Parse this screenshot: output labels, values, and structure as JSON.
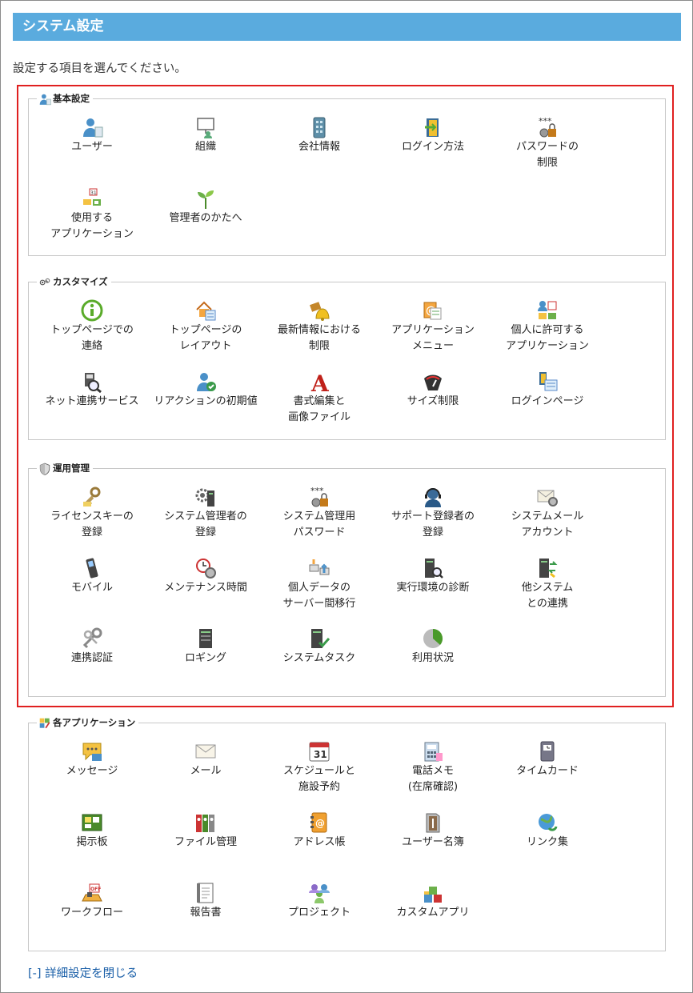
{
  "page": {
    "title": "システム設定",
    "instruction": "設定する項目を選んでください。",
    "footer_link": "[-] 詳細設定を閉じる"
  },
  "colors": {
    "header": "#5aabde",
    "highlight": "#e02020",
    "link": "#1a5fa8"
  },
  "sections": [
    {
      "title": "基本設定",
      "icon": "user-icon",
      "items": [
        {
          "label": "ユーザー",
          "icon": "user-icon"
        },
        {
          "label": "組織",
          "icon": "organization-icon"
        },
        {
          "label": "会社情報",
          "icon": "building-icon"
        },
        {
          "label": "ログイン方法",
          "icon": "door-icon"
        },
        {
          "label": "パスワードの\n制限",
          "icon": "password-lock-icon"
        },
        {
          "label": "使用する\nアプリケーション",
          "icon": "apps-icon"
        },
        {
          "label": "管理者のかたへ",
          "icon": "sprout-icon"
        }
      ]
    },
    {
      "title": "カスタマイズ",
      "icon": "gear-wrench-icon",
      "items": [
        {
          "label": "トップページでの\n連絡",
          "icon": "info-icon"
        },
        {
          "label": "トップページの\nレイアウト",
          "icon": "home-layout-icon"
        },
        {
          "label": "最新情報における\n制限",
          "icon": "bell-icon"
        },
        {
          "label": "アプリケーション\nメニュー",
          "icon": "app-menu-icon"
        },
        {
          "label": "個人に許可する\nアプリケーション",
          "icon": "personal-apps-icon"
        },
        {
          "label": "ネット連携サービス",
          "icon": "net-service-icon"
        },
        {
          "label": "リアクションの初期値",
          "icon": "user-check-icon"
        },
        {
          "label": "書式編集と\n画像ファイル",
          "icon": "font-icon"
        },
        {
          "label": "サイズ制限",
          "icon": "gauge-icon"
        },
        {
          "label": "ログインページ",
          "icon": "login-page-icon"
        }
      ]
    },
    {
      "title": "運用管理",
      "icon": "shield-icon",
      "items": [
        {
          "label": "ライセンスキーの\n登録",
          "icon": "license-key-icon"
        },
        {
          "label": "システム管理者の\n登録",
          "icon": "gear-server-icon"
        },
        {
          "label": "システム管理用\nパスワード",
          "icon": "password-lock-icon"
        },
        {
          "label": "サポート登録者の\n登録",
          "icon": "support-headset-icon"
        },
        {
          "label": "システムメール\nアカウント",
          "icon": "mail-gear-icon"
        },
        {
          "label": "モバイル",
          "icon": "mobile-icon"
        },
        {
          "label": "メンテナンス時間",
          "icon": "clock-gear-icon"
        },
        {
          "label": "個人データの\nサーバー間移行",
          "icon": "data-transfer-icon"
        },
        {
          "label": "実行環境の診断",
          "icon": "server-diagnosis-icon"
        },
        {
          "label": "他システム\nとの連携",
          "icon": "server-link-icon"
        },
        {
          "label": "連携認証",
          "icon": "keys-icon"
        },
        {
          "label": "ロギング",
          "icon": "server-log-icon"
        },
        {
          "label": "システムタスク",
          "icon": "server-check-icon"
        },
        {
          "label": "利用状況",
          "icon": "pie-icon"
        }
      ]
    },
    {
      "title": "各アプリケーション",
      "icon": "apps-edit-icon",
      "items": [
        {
          "label": "メッセージ",
          "icon": "message-icon"
        },
        {
          "label": "メール",
          "icon": "mail-icon"
        },
        {
          "label": "スケジュールと\n施設予約",
          "icon": "calendar-icon"
        },
        {
          "label": "電話メモ\n(在席確認)",
          "icon": "phone-icon"
        },
        {
          "label": "タイムカード",
          "icon": "timecard-icon"
        },
        {
          "label": "掲示板",
          "icon": "board-icon"
        },
        {
          "label": "ファイル管理",
          "icon": "binders-icon"
        },
        {
          "label": "アドレス帳",
          "icon": "address-book-icon"
        },
        {
          "label": "ユーザー名簿",
          "icon": "user-directory-icon"
        },
        {
          "label": "リンク集",
          "icon": "globe-link-icon"
        },
        {
          "label": "ワークフロー",
          "icon": "workflow-icon"
        },
        {
          "label": "報告書",
          "icon": "report-icon"
        },
        {
          "label": "プロジェクト",
          "icon": "project-icon"
        },
        {
          "label": "カスタムアプリ",
          "icon": "custom-app-icon"
        }
      ]
    }
  ]
}
